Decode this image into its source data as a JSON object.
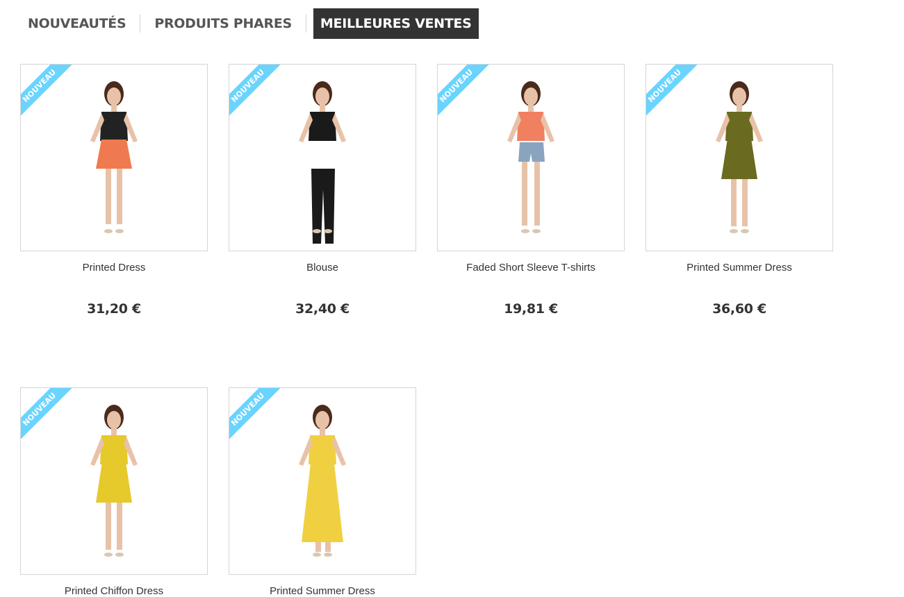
{
  "tabs": [
    {
      "label": "NOUVEAUTÉS",
      "active": false
    },
    {
      "label": "PRODUITS PHARES",
      "active": false
    },
    {
      "label": "MEILLEURES VENTES",
      "active": true
    }
  ],
  "ribbon_label": "NOUVEAU",
  "products": [
    {
      "name": "Printed Dress",
      "price": "31,20 €",
      "top_color": "#222222",
      "bottom_color": "#f07a4f",
      "type": "skirt"
    },
    {
      "name": "Blouse",
      "price": "32,40 €",
      "top_color": "#1a1a1a",
      "bottom_color": "#1a1a1a",
      "type": "pants"
    },
    {
      "name": "Faded Short Sleeve T-shirts",
      "price": "19,81 €",
      "top_color": "#f08060",
      "bottom_color": "#8aa4c0",
      "type": "shorts"
    },
    {
      "name": "Printed Summer Dress",
      "price": "36,60 €",
      "top_color": "#6a6a20",
      "bottom_color": "#6a6a20",
      "type": "dress"
    },
    {
      "name": "Printed Chiffon Dress",
      "price": "",
      "top_color": "#e6c92a",
      "bottom_color": "#e6c92a",
      "type": "dress"
    },
    {
      "name": "Printed Summer Dress",
      "price": "",
      "top_color": "#f0d040",
      "bottom_color": "#f0d040",
      "type": "maxi"
    }
  ]
}
